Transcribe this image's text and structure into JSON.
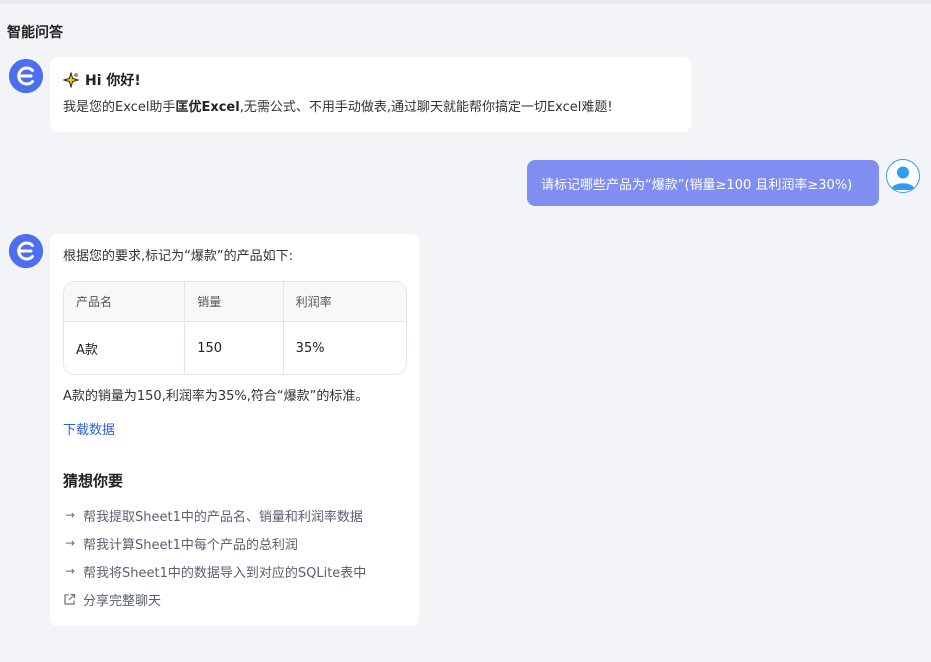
{
  "page": {
    "title": "智能问答"
  },
  "colors": {
    "accent": "#4e6ef2",
    "user_bubble": "#7f8ef0",
    "link": "#2b62d8"
  },
  "greeting": {
    "title": "Hi 你好!",
    "text_prefix": "我是您的Excel助手",
    "brand": "匡优Excel",
    "text_suffix": ",无需公式、不用手动做表,通过聊天就能帮你搞定一切Excel难题!"
  },
  "user_message": {
    "text": "请标记哪些产品为“爆款”(销量≥100 且利润率≥30%)"
  },
  "answer": {
    "intro": "根据您的要求,标记为“爆款”的产品如下:",
    "table": {
      "headers": [
        "产品名",
        "销量",
        "利润率"
      ],
      "rows": [
        [
          "A款",
          "150",
          "35%"
        ]
      ]
    },
    "summary": "A款的销量为150,利润率为35%,符合“爆款”的标准。",
    "download_label": "下载数据",
    "guess_title": "猜想你要",
    "suggestions": [
      {
        "icon": "arrow-right-icon",
        "text": "帮我提取Sheet1中的产品名、销量和利润率数据"
      },
      {
        "icon": "arrow-right-icon",
        "text": "帮我计算Sheet1中每个产品的总利润"
      },
      {
        "icon": "arrow-right-icon",
        "text": "帮我将Sheet1中的数据导入到对应的SQLite表中"
      },
      {
        "icon": "share-icon",
        "text": "分享完整聊天"
      }
    ]
  }
}
